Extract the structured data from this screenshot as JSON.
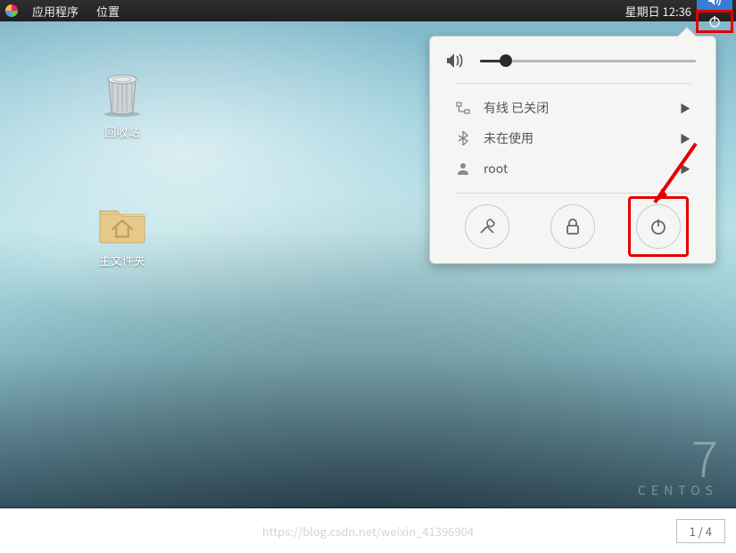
{
  "topbar": {
    "applications_label": "应用程序",
    "places_label": "位置",
    "clock": "星期日 12:36"
  },
  "desktop_icons": {
    "trash_label": "回收站",
    "home_label": "主文件夹"
  },
  "system_menu": {
    "volume_percent": 12,
    "wired": {
      "label": "有线 已关闭"
    },
    "bluetooth": {
      "label": "未在使用"
    },
    "user": {
      "label": "root"
    }
  },
  "os_brand": {
    "version": "7",
    "name": "CENTOS"
  },
  "footer": {
    "watermark": "https://blog.csdn.net/weixin_41396904",
    "page_indicator": "1 / 4"
  }
}
